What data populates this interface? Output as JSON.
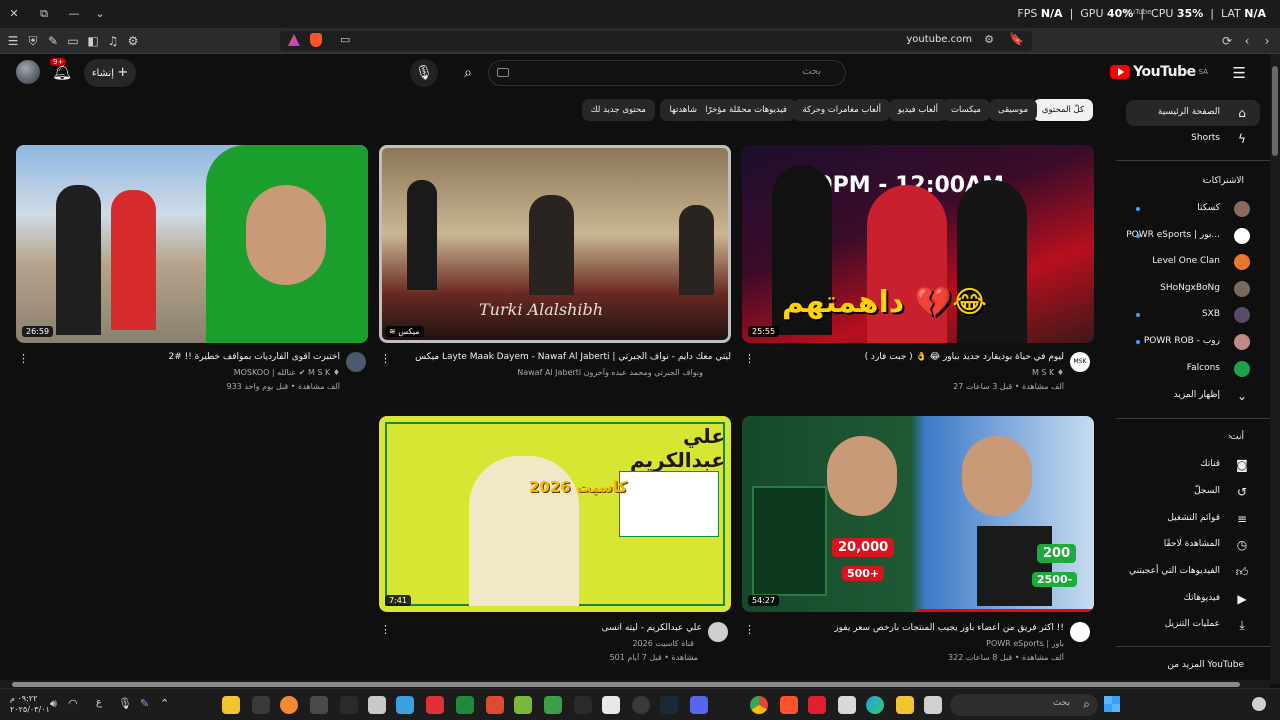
{
  "titlebar": {
    "fps_label": "FPS",
    "fps_value": "N/A",
    "gpu_label": "GPU",
    "gpu_value": "40%",
    "cpu_label": "CPU",
    "cpu_value": "35%",
    "lat_label": "LAT",
    "lat_value": "N/A",
    "overlay_tab": "YouTube"
  },
  "browser": {
    "url": "youtube.com"
  },
  "header": {
    "create_label": "إنشاء",
    "notification_count": "9+",
    "search_placeholder": "بحث",
    "logo_text": "YouTube",
    "logo_region": "SA"
  },
  "chips": [
    {
      "label": "كلّ المحتوى",
      "active": true
    },
    {
      "label": "موسيقى"
    },
    {
      "label": "ميكسات"
    },
    {
      "label": "ألعاب فيديو"
    },
    {
      "label": "ألعاب مغامرات وحركة"
    },
    {
      "label": "فيديوهات محمّلة مؤخرًا"
    },
    {
      "label": "شاهدتها"
    },
    {
      "label": "محتوى جديد لك"
    }
  ],
  "sidebar": {
    "home": "الصفحة الرئيسية",
    "shorts": "Shorts",
    "subscriptions_heading": "الاشتراكات",
    "subscriptions": [
      {
        "label": "كسكتا",
        "dot": true,
        "color": "#8a6a5a"
      },
      {
        "label": "POWR eSports | بور...",
        "dot": true,
        "color": "#ffffff"
      },
      {
        "label": "Level One Clan",
        "dot": false,
        "color": "#e8772e"
      },
      {
        "label": "SHoNgxBoNg",
        "dot": false,
        "color": "#7a6a5e"
      },
      {
        "label": "SXB",
        "dot": true,
        "color": "#5a4a6a"
      },
      {
        "label": "POWR ROB - روب",
        "dot": true,
        "color": "#c08a8a"
      },
      {
        "label": "Falcons",
        "dot": false,
        "color": "#1fa34a"
      }
    ],
    "show_more": "إظهار المزيد",
    "you_heading": "أنت",
    "you_items": [
      {
        "label": "قناتك",
        "icon": "account-box-icon"
      },
      {
        "label": "السجلّ",
        "icon": "history-icon"
      },
      {
        "label": "قوائم التشغيل",
        "icon": "playlists-icon"
      },
      {
        "label": "المشاهدة لاحقًا",
        "icon": "watch-later-icon"
      },
      {
        "label": "الفيديوهات التي أعجبتني",
        "icon": "like-icon"
      },
      {
        "label": "فيديوهاتك",
        "icon": "your-videos-icon"
      },
      {
        "label": "عمليات التنزيل",
        "icon": "download-icon"
      }
    ],
    "more_from_youtube": "المزيد من YouTube"
  },
  "videos": [
    {
      "title": "ليوم في حياة بوديقارد جديد بباور 😂 👌 ( جبت فارد )",
      "channel": "M S K ♦",
      "meta": "27 ألف مشاهدة • قبل 3 ساعات",
      "duration": "25:55",
      "thumb_text": "داهمتهم 💔😂"
    },
    {
      "title": "ميكس Layte Maak Dayem - Nawaf Al Jaberti | ليتي معك دايم - نواف الجبرتي",
      "channel": "Nawaf Al Jaberti ونواف الجبرتي ومحمد عبده وآخرون",
      "meta": "",
      "duration": "ميكس",
      "thumb_text": "Turki Alalshibh"
    },
    {
      "title": "اختبرت اقوى الفارديات بمواقف خطيرة !! #2",
      "channel": "MOSKOO | عنالله ✔ M S K ♦",
      "meta": "933 ألف مشاهدة • قبل يوم واحد",
      "duration": "26:59",
      "thumb_text": ""
    },
    {
      "title": "اكثر فريق من اعضاء باور يجيب المنتجات بأرخص سعر يفوز !!",
      "channel": "POWR eSports | باور",
      "meta": "322 ألف مشاهدة • قبل 8 ساعات",
      "duration": "54:27",
      "thumb_text_a": "20,000",
      "thumb_text_b": "500+",
      "thumb_text_c": "200",
      "thumb_text_d": "2500-"
    },
    {
      "title": "علي عبدالكريم - ليته انسى",
      "channel": "قناة كاسيت 2026",
      "meta": "501 مشاهدة • قبل 7 أيام",
      "duration": "7:41",
      "thumb_text": "علي عبدالكريم",
      "thumb_text2": "كاسيت 2026"
    }
  ],
  "taskbar": {
    "search_placeholder": "بحث",
    "time": "٠٩:٢٢ م",
    "date": "٢٠٢٥/٠٣/٠١",
    "lang": "ع"
  }
}
